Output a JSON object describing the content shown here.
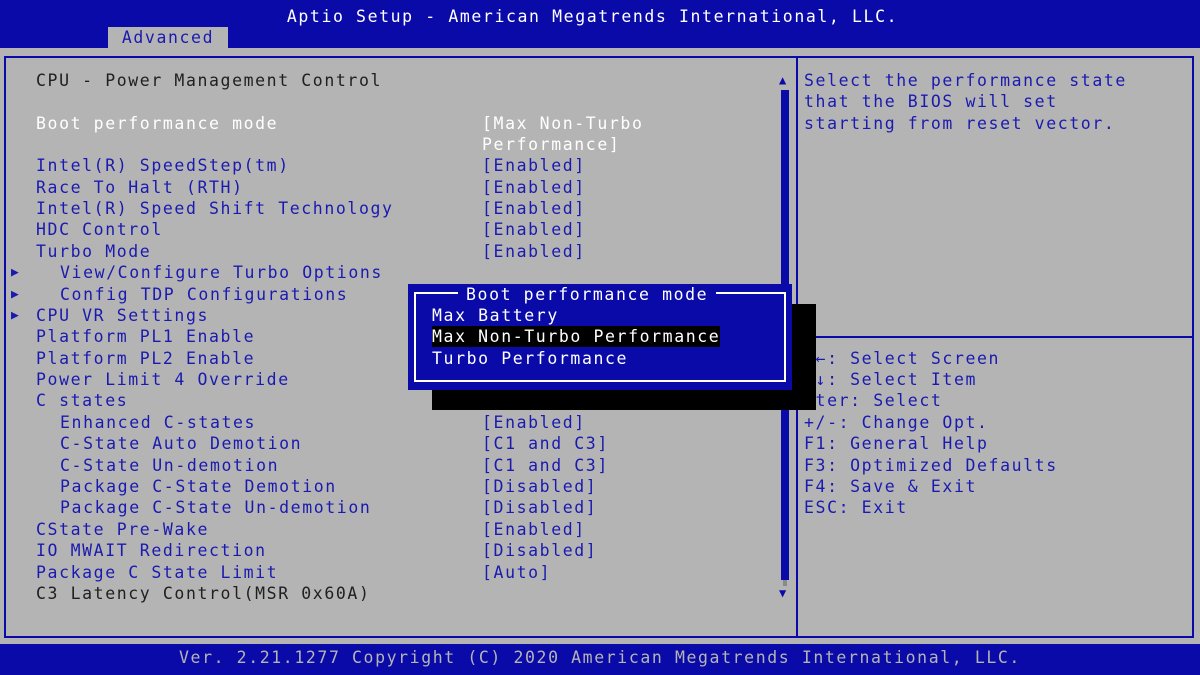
{
  "header": {
    "title": "Aptio Setup - American Megatrends International, LLC."
  },
  "tabs": [
    {
      "label": "Advanced"
    }
  ],
  "main": {
    "section_title": "CPU - Power Management Control",
    "selected_item": {
      "label": "Boot performance mode",
      "value_line1": "[Max Non-Turbo",
      "value_line2": "Performance]"
    },
    "items": [
      {
        "label": "Intel(R) SpeedStep(tm)",
        "value": "[Enabled]"
      },
      {
        "label": "Race To Halt (RTH)",
        "value": "[Enabled]"
      },
      {
        "label": "Intel(R) Speed Shift Technology",
        "value": "[Enabled]"
      },
      {
        "label": "HDC Control",
        "value": "[Enabled]"
      },
      {
        "label": "Turbo Mode",
        "value": "[Enabled]"
      },
      {
        "label": "View/Configure Turbo Options",
        "submenu": true
      },
      {
        "label": "Config TDP Configurations",
        "submenu": true
      },
      {
        "label": "CPU VR Settings",
        "submenu": true
      },
      {
        "label": "Platform PL1 Enable"
      },
      {
        "label": "Platform PL2 Enable"
      },
      {
        "label": "Power Limit 4 Override"
      },
      {
        "label": "C states"
      },
      {
        "label": "Enhanced C-states",
        "value": "[Enabled]"
      },
      {
        "label": "C-State Auto Demotion",
        "value": "[C1 and C3]"
      },
      {
        "label": "C-State Un-demotion",
        "value": "[C1 and C3]"
      },
      {
        "label": "Package C-State Demotion",
        "value": "[Disabled]"
      },
      {
        "label": "Package C-State Un-demotion",
        "value": "[Disabled]"
      },
      {
        "label": "CState Pre-Wake",
        "value": "[Enabled]"
      },
      {
        "label": "IO MWAIT Redirection",
        "value": "[Disabled]"
      },
      {
        "label": "Package C State Limit",
        "value": "[Auto]"
      },
      {
        "label": "C3 Latency Control(MSR 0x60A)"
      }
    ],
    "submenu_arrow": "▶",
    "scroll_up": "▲",
    "scroll_down": "▼"
  },
  "help": {
    "lines": [
      "Select the performance state",
      "that the BIOS will set",
      "starting from reset vector."
    ]
  },
  "keys": [
    "→←: Select Screen",
    "↑↓: Select Item",
    "nter: Select",
    "+/-: Change Opt.",
    "F1: General Help",
    "F3: Optimized Defaults",
    "F4: Save & Exit",
    "ESC: Exit"
  ],
  "popup": {
    "title": "Boot performance mode",
    "options": [
      "Max Battery",
      "Max Non-Turbo Performance",
      "Turbo Performance"
    ],
    "selected_index": 1
  },
  "footer": {
    "text": "Ver. 2.21.1277 Copyright (C) 2020 American Megatrends International, LLC."
  },
  "colors": {
    "background": "#0a0aa8",
    "panel": "#b4b4b4",
    "highlight": "#ffffff",
    "item_text": "#1a1ab0"
  }
}
